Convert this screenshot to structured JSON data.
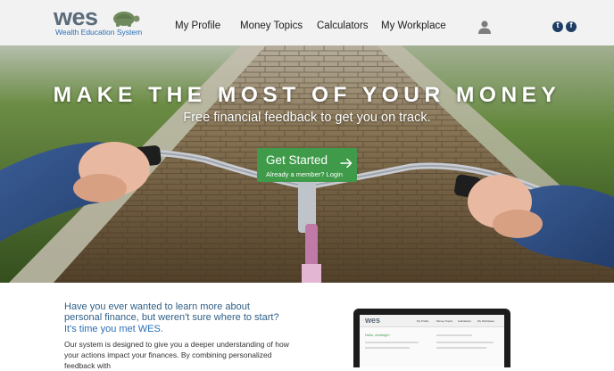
{
  "brand": {
    "logo_text": "wes",
    "tagline": "Wealth Education System"
  },
  "nav": {
    "items": [
      "My Profile",
      "Money Topics",
      "Calculators",
      "My Workplace"
    ]
  },
  "icons": {
    "user": "user-icon",
    "twitter": "twitter-icon",
    "facebook": "facebook-icon",
    "arrow": "arrow-right-icon"
  },
  "social": {
    "twitter_glyph": "t",
    "facebook_glyph": "f"
  },
  "hero": {
    "title": "MAKE THE MOST OF YOUR MONEY",
    "subtitle": "Free financial feedback to get you on track.",
    "cta_label": "Get Started",
    "cta_sublabel": "Already a member? Login"
  },
  "content": {
    "heading": "Have you ever wanted to learn more about personal finance, but weren't sure where to start?",
    "subheading": "It's time you met WES.",
    "body": "Our system is designed to give you a deeper understanding of how your actions impact your finances. By combining personalized feedback with"
  },
  "laptop": {
    "logo_text": "wes",
    "nav": [
      "My Profile",
      "Money Topics",
      "Calculators",
      "My Workplace"
    ],
    "greeting": "Hello, Ashleigh!"
  },
  "colors": {
    "header_bg": "#f2f2f2",
    "cta_green": "#3f9b4a",
    "heading_blue": "#2f5f86",
    "link_blue": "#2a6fb5",
    "social_navy": "#1f3d63"
  }
}
